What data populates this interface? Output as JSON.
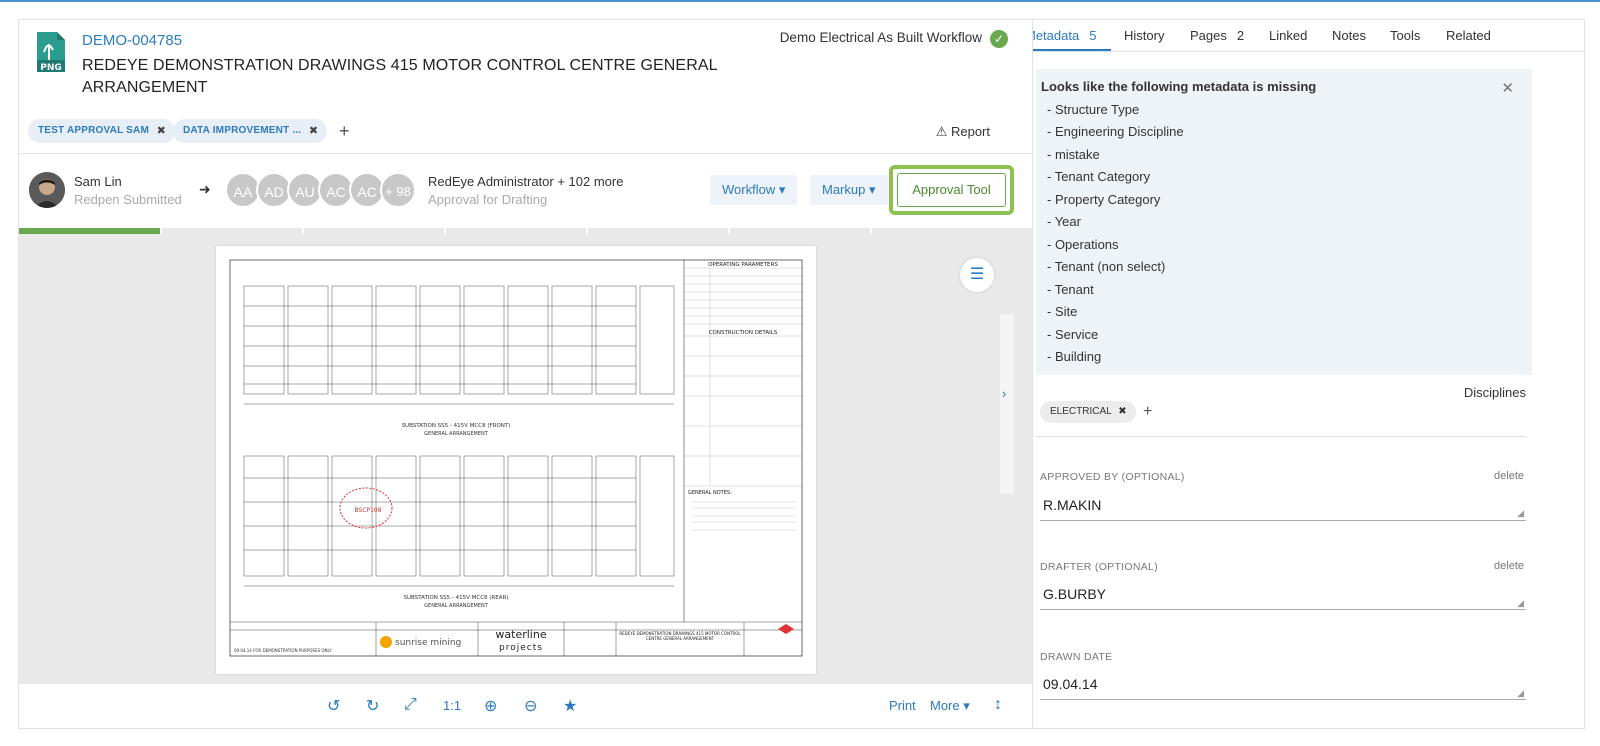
{
  "document": {
    "file_type": "PNG",
    "id": "DEMO-004785",
    "title": "REDEYE DEMONSTRATION DRAWINGS 415 MOTOR CONTROL CENTRE GENERAL ARRANGEMENT",
    "workflow_name": "Demo Electrical As Built Workflow",
    "tags": [
      "TEST APPROVAL SAM",
      "DATA IMPROVEMENT ..."
    ],
    "report_label": "Report"
  },
  "approval": {
    "submitter_name": "Sam Lin",
    "submitter_role": "Redpen Submitted",
    "approver_initials": [
      "AA",
      "AD",
      "AU",
      "AC",
      "AC",
      "+ 98"
    ],
    "approver_name": "RedEye Administrator + 102 more",
    "approver_role": "Approval for Drafting",
    "workflow_button": "Workflow",
    "markup_button": "Markup",
    "approval_tool_button": "Approval Tool",
    "progress_fraction": 0.14
  },
  "drawing": {
    "sheet_title": "OPERATING PARAMETERS",
    "section_title": "CONSTRUCTION DETAILS",
    "notes_title": "GENERAL NOTES:",
    "front_caption": "SUBSTATION SS5 - 415V MCC8 (FRONT)",
    "front_sub": "GENERAL ARRANGEMENT",
    "rear_caption": "SUBSTATION SS5 - 415V MCC8 (REAR)",
    "rear_sub": "GENERAL ARRANGEMENT",
    "client_logo": "sunrise mining",
    "consultant_logo_1": "waterline",
    "consultant_logo_2": "projects",
    "title_block": "REDEYE DEMONSTRATION DRAWINGS 415 MOTOR CONTROL CENTRE GENERAL ARRANGEMENT",
    "markup_text": "BSCP108",
    "revision_row": "09.04.14  FOR DEMONSTRATION PURPOSES ONLY"
  },
  "toolbar": {
    "zoom_label": "1:1",
    "print_label": "Print",
    "more_label": "More"
  },
  "tabs": [
    {
      "label": "Metadata",
      "count": "5"
    },
    {
      "label": "History",
      "count": ""
    },
    {
      "label": "Pages",
      "count": "2"
    },
    {
      "label": "Linked",
      "count": ""
    },
    {
      "label": "Notes",
      "count": ""
    },
    {
      "label": "Tools",
      "count": ""
    },
    {
      "label": "Related",
      "count": ""
    }
  ],
  "missing_metadata": {
    "title": "Looks like the following metadata is missing",
    "items": [
      "- Structure Type",
      "- Engineering Discipline",
      "- mistake",
      "- Tenant Category",
      "- Property Category",
      "- Year",
      "- Operations",
      "- Tenant (non select)",
      "- Tenant",
      "- Site",
      "- Service",
      "- Building"
    ]
  },
  "disciplines": {
    "label": "Disciplines",
    "tags": [
      "ELECTRICAL"
    ]
  },
  "fields": [
    {
      "label": "APPROVED BY (OPTIONAL)",
      "value": "R.MAKIN",
      "delete": "delete"
    },
    {
      "label": "DRAFTER (OPTIONAL)",
      "value": "G.BURBY",
      "delete": "delete"
    },
    {
      "label": "DRAWN DATE",
      "value": "09.04.14",
      "delete": ""
    }
  ],
  "colors": {
    "accent": "#2b7bbf",
    "approval_green": "#8cc152",
    "success": "#6aa84f"
  }
}
